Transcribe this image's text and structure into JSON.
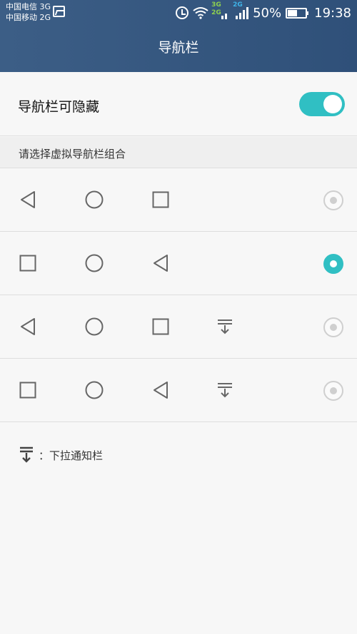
{
  "status_bar": {
    "carrier_1": "中国电信 3G",
    "carrier_2": "中国移动 2G",
    "network_tag_1_top": "3G",
    "network_tag_1_bottom": "2G",
    "network_tag_2": "2G",
    "battery_percent": "50%",
    "time": "19:38"
  },
  "header": {
    "title": "导航栏"
  },
  "hide_setting": {
    "label": "导航栏可隐藏",
    "enabled": true
  },
  "section": {
    "title": "请选择虚拟导航栏组合"
  },
  "options": [
    {
      "icons": [
        "back-icon",
        "home-icon",
        "recent-icon"
      ],
      "selected": false
    },
    {
      "icons": [
        "recent-icon",
        "home-icon",
        "back-icon"
      ],
      "selected": true
    },
    {
      "icons": [
        "back-icon",
        "home-icon",
        "recent-icon",
        "notification-pull-icon"
      ],
      "selected": false
    },
    {
      "icons": [
        "recent-icon",
        "home-icon",
        "back-icon",
        "notification-pull-icon"
      ],
      "selected": false
    }
  ],
  "legend": {
    "text": "：下拉通知栏"
  },
  "colors": {
    "header": "#345881",
    "accent": "#30bfc3",
    "background": "#f7f7f7"
  }
}
